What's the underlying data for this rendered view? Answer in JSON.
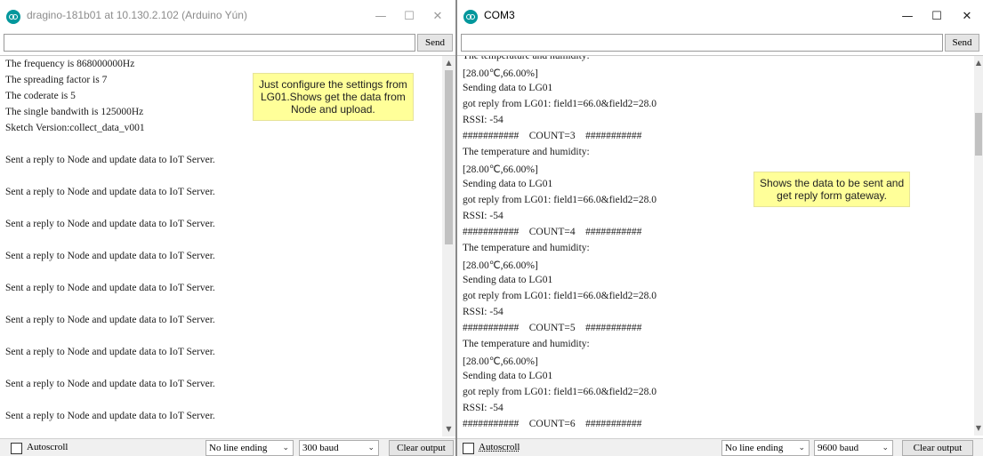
{
  "left_window": {
    "title": "dragino-181b01 at 10.130.2.102 (Arduino Yún)",
    "controls": {
      "minimize": "—",
      "maximize": "☐",
      "close": "✕"
    },
    "input_value": "",
    "send_label": "Send",
    "lines": [
      "The frequency is 868000000Hz",
      "The spreading factor is 7",
      "The coderate is 5",
      "The single bandwith is 125000Hz",
      "Sketch Version:collect_data_v001",
      "",
      "Sent a reply to Node and update data to IoT Server.",
      "",
      "Sent a reply to Node and update data to IoT Server.",
      "",
      "Sent a reply to Node and update data to IoT Server.",
      "",
      "Sent a reply to Node and update data to IoT Server.",
      "",
      "Sent a reply to Node and update data to IoT Server.",
      "",
      "Sent a reply to Node and update data to IoT Server.",
      "",
      "Sent a reply to Node and update data to IoT Server.",
      "",
      "Sent a reply to Node and update data to IoT Server.",
      "",
      "Sent a reply to Node and update data to IoT Server."
    ],
    "note": "Just configure the settings from\nLG01.Shows get the data from\nNode and upload.",
    "autoscroll_label": "Autoscroll",
    "autoscroll_checked": false,
    "line_ending": "No line ending",
    "baud": "300 baud",
    "clear_label": "Clear output"
  },
  "right_window": {
    "title": "COM3",
    "controls": {
      "minimize": "—",
      "maximize": "☐",
      "close": "✕"
    },
    "input_value": "",
    "send_label": "Send",
    "lines": [
      "The temperature and humidity:",
      "[28.00℃,66.00%]",
      "Sending data to LG01",
      "got reply from LG01: field1=66.0&field2=28.0",
      "RSSI: -54",
      "###########    COUNT=3    ###########",
      "The temperature and humidity:",
      "[28.00℃,66.00%]",
      "Sending data to LG01",
      "got reply from LG01: field1=66.0&field2=28.0",
      "RSSI: -54",
      "###########    COUNT=4    ###########",
      "The temperature and humidity:",
      "[28.00℃,66.00%]",
      "Sending data to LG01",
      "got reply from LG01: field1=66.0&field2=28.0",
      "RSSI: -54",
      "###########    COUNT=5    ###########",
      "The temperature and humidity:",
      "[28.00℃,66.00%]",
      "Sending data to LG01",
      "got reply from LG01: field1=66.0&field2=28.0",
      "RSSI: -54",
      "###########    COUNT=6    ###########"
    ],
    "note": "Shows the data to be sent and\nget reply form gateway.",
    "autoscroll_label": "Autoscroll",
    "autoscroll_checked": false,
    "line_ending": "No line ending",
    "baud": "9600 baud",
    "clear_label": "Clear output"
  },
  "colors": {
    "arduino_icon": "#00979c",
    "note_background": "#ffff99",
    "inactive_title": "#8c8c8c"
  },
  "icons": {
    "app": "arduino-icon",
    "scroll_up": "▲",
    "scroll_down": "▼",
    "dropdown": "⌄"
  }
}
